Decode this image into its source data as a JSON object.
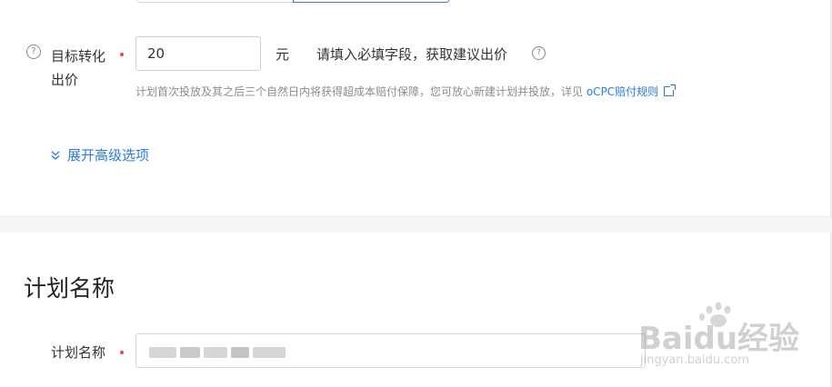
{
  "bid_field": {
    "label": "目标转化出价",
    "value": "20",
    "unit": "元",
    "hint": "请填入必填字段，获取建议出价",
    "description": "计划首次投放及其之后三个自然日内将获得超成本赔付保障，您可放心新建计划并投放，详见",
    "link_text": "oCPC赔付规则",
    "help_icon": "question-circle-icon",
    "link_icon": "external-link-icon"
  },
  "advanced": {
    "label": "展开高级选项",
    "icon": "double-chevron-down-icon"
  },
  "plan_section": {
    "title": "计划名称",
    "field_label": "计划名称"
  },
  "colors": {
    "accent": "#2a7ae2",
    "required": "#e84a4a",
    "active_border": "#3a7ce8"
  },
  "watermark": {
    "brand": "Baidu经验",
    "url": "jingyan.baidu.com"
  }
}
